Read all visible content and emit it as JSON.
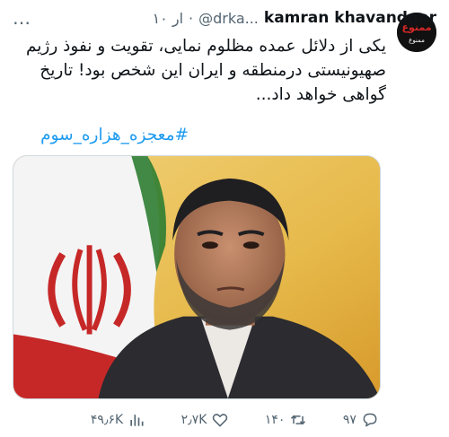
{
  "tweet": {
    "author_name": "kamran khavandgar",
    "handle": "@drka...",
    "separator": "·",
    "time": "۱۰ ار",
    "text": "یکی از دلائل عمده مظلوم نمایی، تقویت و نفوذ رژیم صهیونیستی درمنطقه و ایران این شخص بود! تاریخ گواهی خواهد داد...",
    "hashtag": "#معجزه_هزاره_سوم",
    "more_label": "…",
    "avatar_lettering": "ممنوع"
  },
  "actions": {
    "replies": "۹۷",
    "retweets": "۱۴۰",
    "likes": "۲٫۷K",
    "views": "۴۹٫۶K"
  },
  "colors": {
    "text": "#0f1419",
    "secondary": "#536471",
    "link": "#1d9bf0"
  },
  "icons": {
    "reply": "reply-icon",
    "retweet": "retweet-icon",
    "like": "heart-icon",
    "views": "views-icon",
    "bookmark": "bookmark-icon",
    "share": "share-icon"
  }
}
